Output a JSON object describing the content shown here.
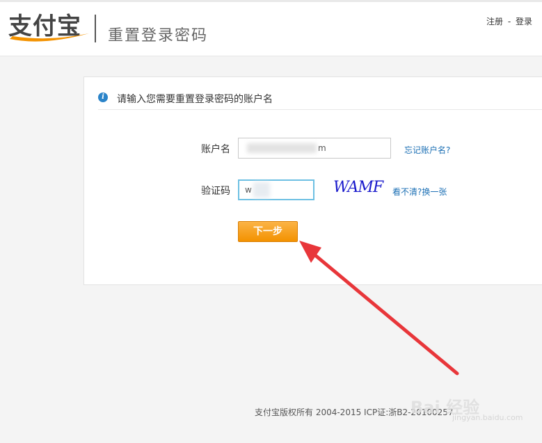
{
  "header": {
    "logo_text": "支付宝",
    "page_title": "重置登录密码",
    "register_link": "注册",
    "link_separator": "-",
    "login_link": "登录"
  },
  "card": {
    "info_title": "请输入您需要重置登录密码的账户名",
    "account": {
      "label": "账户名",
      "value_visible_suffix": "m",
      "forgot_link": "忘记账户名?"
    },
    "captcha": {
      "label": "验证码",
      "value_visible": "w",
      "image_text": "WAMF",
      "refresh_link": "看不清?换一张"
    },
    "next_button": "下一步"
  },
  "footer": {
    "copyright": "支付宝版权所有 2004-2015 ICP证:浙B2-20100257"
  },
  "watermark": {
    "text": "Bai 经验",
    "sub": "jingyan.baidu.com"
  },
  "colors": {
    "accent_orange": "#f39200",
    "link_blue": "#1b6fb4",
    "arrow_red": "#e8363a",
    "captcha_blue": "#1a1acc"
  }
}
